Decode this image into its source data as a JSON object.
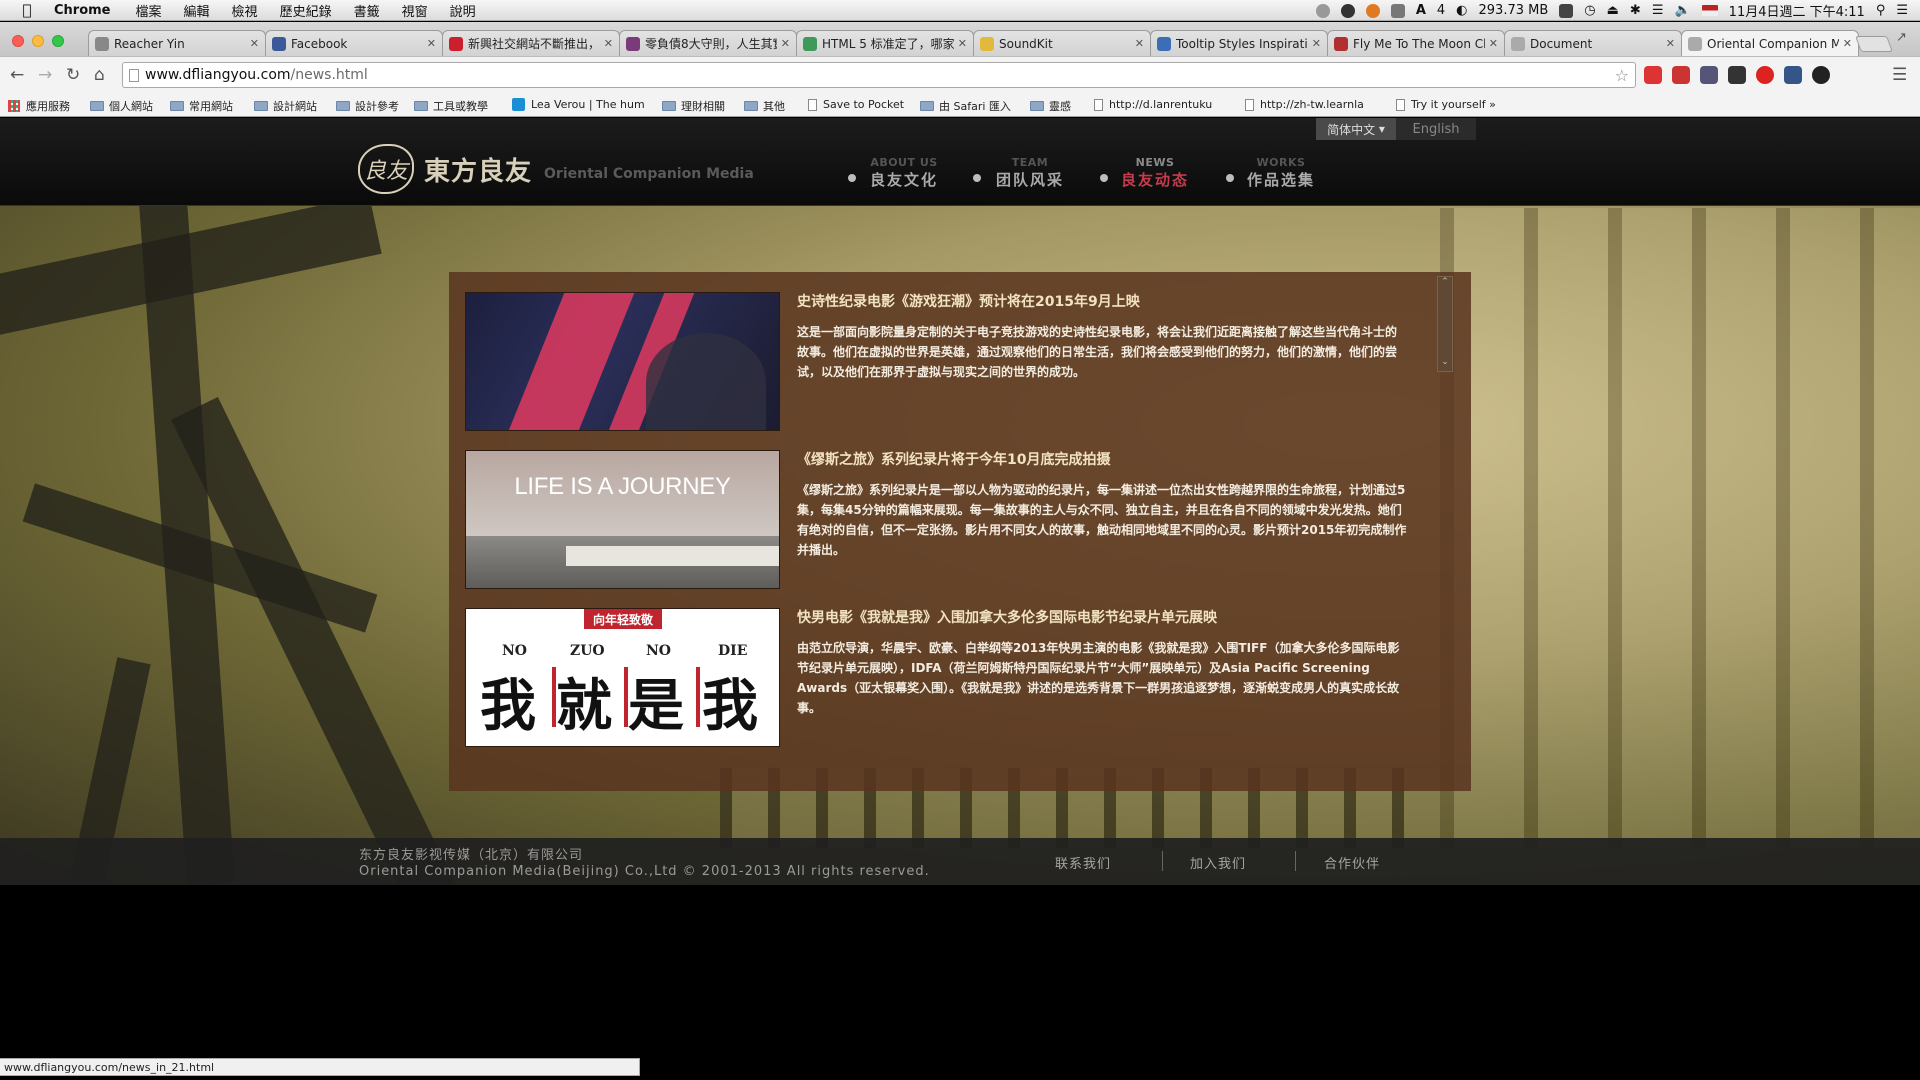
{
  "menubar": {
    "app": "Chrome",
    "items": [
      "檔案",
      "編輯",
      "檢視",
      "歷史紀錄",
      "書籤",
      "視窗",
      "說明"
    ],
    "battery_text": "4",
    "memory": "293.73 MB",
    "datetime": "11月4日週二 下午4:11"
  },
  "tabs": [
    {
      "title": "Reacher Yin",
      "color": "#888888"
    },
    {
      "title": "Facebook",
      "color": "#3b5998"
    },
    {
      "title": "新興社交網站不斷推出，",
      "color": "#cc1f2d"
    },
    {
      "title": "零負債8大守則，人生其實",
      "color": "#7a3b7a"
    },
    {
      "title": "HTML 5 标准定了，哪家…",
      "color": "#3d9a5a"
    },
    {
      "title": "SoundKit",
      "color": "#e2b93b"
    },
    {
      "title": "Tooltip Styles Inspiratio",
      "color": "#3a6fb5"
    },
    {
      "title": "Fly Me To The Moon Cl",
      "color": "#b03030"
    },
    {
      "title": "Document",
      "color": "#aaaaaa"
    },
    {
      "title": "Oriental Companion Me",
      "color": "#aaaaaa"
    }
  ],
  "address": {
    "domain": "www.dfliangyou.com",
    "path": "/news.html"
  },
  "bookmarks": [
    {
      "label": "應用服務",
      "type": "apps"
    },
    {
      "label": "個人網站",
      "type": "folder"
    },
    {
      "label": "常用網站",
      "type": "folder"
    },
    {
      "label": "設計網站",
      "type": "folder"
    },
    {
      "label": "設計參考",
      "type": "folder"
    },
    {
      "label": "工具或教學",
      "type": "folder"
    },
    {
      "label": "Lea Verou | The hum",
      "type": "site"
    },
    {
      "label": "理財相關",
      "type": "folder"
    },
    {
      "label": "其他",
      "type": "folder"
    },
    {
      "label": "Save to Pocket",
      "type": "doc"
    },
    {
      "label": "由 Safari 匯入",
      "type": "folder"
    },
    {
      "label": "靈感",
      "type": "folder"
    },
    {
      "label": "http://d.lanrentuku",
      "type": "doc"
    },
    {
      "label": "http://zh-tw.learnla",
      "type": "doc"
    },
    {
      "label": "Try it yourself »",
      "type": "doc"
    }
  ],
  "site": {
    "lang": {
      "zh": "简体中文",
      "en": "English"
    },
    "logo": {
      "mark": "良友",
      "cn": "東方良友",
      "en": "Oriental Companion Media"
    },
    "nav": [
      {
        "en": "ABOUT US",
        "cn": "良友文化"
      },
      {
        "en": "TEAM",
        "cn": "团队风采"
      },
      {
        "en": "NEWS",
        "cn": "良友动态"
      },
      {
        "en": "WORKS",
        "cn": "作品选集"
      }
    ],
    "news": [
      {
        "title": "史诗性纪录电影《游戏狂潮》预计将在2015年9月上映",
        "desc": "这是一部面向影院量身定制的关于电子竞技游戏的史诗性纪录电影，将会让我们近距离接触了解这些当代角斗士的故事。他们在虚拟的世界是英雄，通过观察他们的日常生活，我们将会感受到他们的努力，他们的激情，他们的尝试，以及他们在那界于虚拟与现实之间的世界的成功。"
      },
      {
        "title": "《缪斯之旅》系列纪录片将于今年10月底完成拍摄",
        "desc": "《缪斯之旅》系列纪录片是一部以人物为驱动的纪录片，每一集讲述一位杰出女性跨越界限的生命旅程，计划通过5集，每集45分钟的篇幅来展现。每一集故事的主人与众不同、独立自主，并且在各自不同的领域中发光发热。她们有绝对的自信，但不一定张扬。影片用不同女人的故事，触动相同地域里不同的心灵。影片预计2015年初完成制作并播出。",
        "thumb_text": "LIFE IS A JOURNEY"
      },
      {
        "title": "快男电影《我就是我》入围加拿大多伦多国际电影节纪录片单元展映",
        "desc": "由范立欣导演，华晨宇、欧豪、白举纲等2013年快男主演的电影《我就是我》入围TIFF（加拿大多伦多国际电影节纪录片单元展映），IDFA（荷兰阿姆斯特丹国际纪录片节“大师”展映单元）及Asia Pacific Screening Awards（亚太银幕奖入围）。《我就是我》讲述的是选秀背景下一群男孩追逐梦想，逐渐蜕变成男人的真实成长故事。",
        "thumb_tag": "向年轻致敬",
        "thumb_pinyin": [
          "NO",
          "ZUO",
          "NO",
          "DIE"
        ],
        "thumb_big": [
          "我",
          "就",
          "是",
          "我"
        ]
      }
    ],
    "footer": {
      "line1": "东方良友影视传媒（北京）有限公司",
      "line2": "Oriental Companion Media(Beijing) Co.,Ltd © 2001-2013 All rights reserved.",
      "links": [
        "联系我们",
        "加入我们",
        "合作伙伴"
      ]
    }
  },
  "status_url": "www.dfliangyou.com/news_in_21.html",
  "colors": {
    "accent": "#c63c4c",
    "panel": "#58341e"
  }
}
